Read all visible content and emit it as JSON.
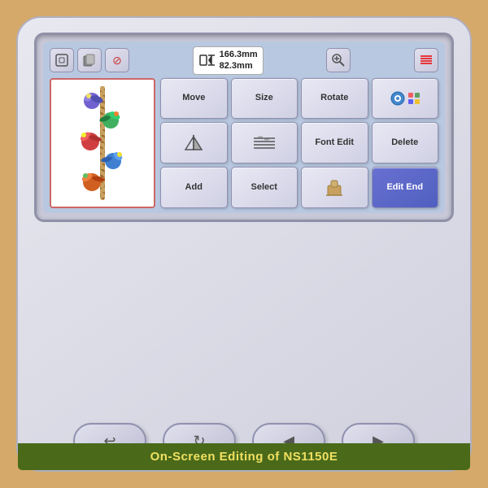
{
  "machine": {
    "title": "On-Screen Editing of NS1150E"
  },
  "screen": {
    "dimensions": {
      "width": "166.3mm",
      "height": "82.3mm"
    }
  },
  "buttons": {
    "row1": [
      {
        "id": "move",
        "label": "Move"
      },
      {
        "id": "size",
        "label": "Size"
      },
      {
        "id": "rotate",
        "label": "Rotate"
      },
      {
        "id": "thread-color",
        "label": "🧵"
      }
    ],
    "row2": [
      {
        "id": "mirror",
        "label": "△▽"
      },
      {
        "id": "stitch-density",
        "label": "≋≋≋"
      },
      {
        "id": "font-edit",
        "label": "Font Edit"
      },
      {
        "id": "delete",
        "label": "Delete"
      }
    ],
    "row3": [
      {
        "id": "add",
        "label": "Add"
      },
      {
        "id": "select",
        "label": "Select"
      },
      {
        "id": "stamp",
        "label": "📋"
      },
      {
        "id": "edit-end",
        "label": "Edit End"
      }
    ]
  },
  "nav_buttons": [
    {
      "id": "back",
      "label": "↩"
    },
    {
      "id": "redo",
      "label": "↻"
    },
    {
      "id": "prev",
      "label": "◀"
    },
    {
      "id": "next",
      "label": "▶"
    }
  ],
  "top_icons": [
    {
      "id": "frame",
      "symbol": "⬚"
    },
    {
      "id": "copy",
      "symbol": "⧉"
    },
    {
      "id": "no-entry",
      "symbol": "🚫"
    },
    {
      "id": "zoom",
      "symbol": "🔍"
    },
    {
      "id": "stitch-count",
      "symbol": "≋"
    }
  ]
}
